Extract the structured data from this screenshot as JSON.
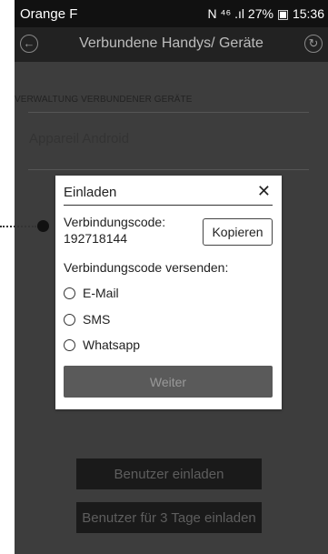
{
  "status": {
    "carrier": "Orange F",
    "right": "N ⁴⁶ .ıl 27% ▣ 15:36"
  },
  "appbar": {
    "title": "Verbundene Handys/ Geräte",
    "back_icon": "←",
    "refresh_icon": "↻"
  },
  "section": {
    "header": "VERWALTUNG VERBUNDENER GERÄTE",
    "device_name": "Appareil Android"
  },
  "dialog": {
    "title": "Einladen",
    "close": "✕",
    "code_label": "Verbindungscode:",
    "code_value": "192718144",
    "copy_label": "Kopieren",
    "send_label": "Verbindungscode versenden:",
    "options": [
      "E-Mail",
      "SMS",
      "Whatsapp"
    ],
    "continue_label": "Weiter"
  },
  "buttons": {
    "invite": "Benutzer einladen",
    "invite_3days": "Benutzer für 3 Tage einladen"
  }
}
